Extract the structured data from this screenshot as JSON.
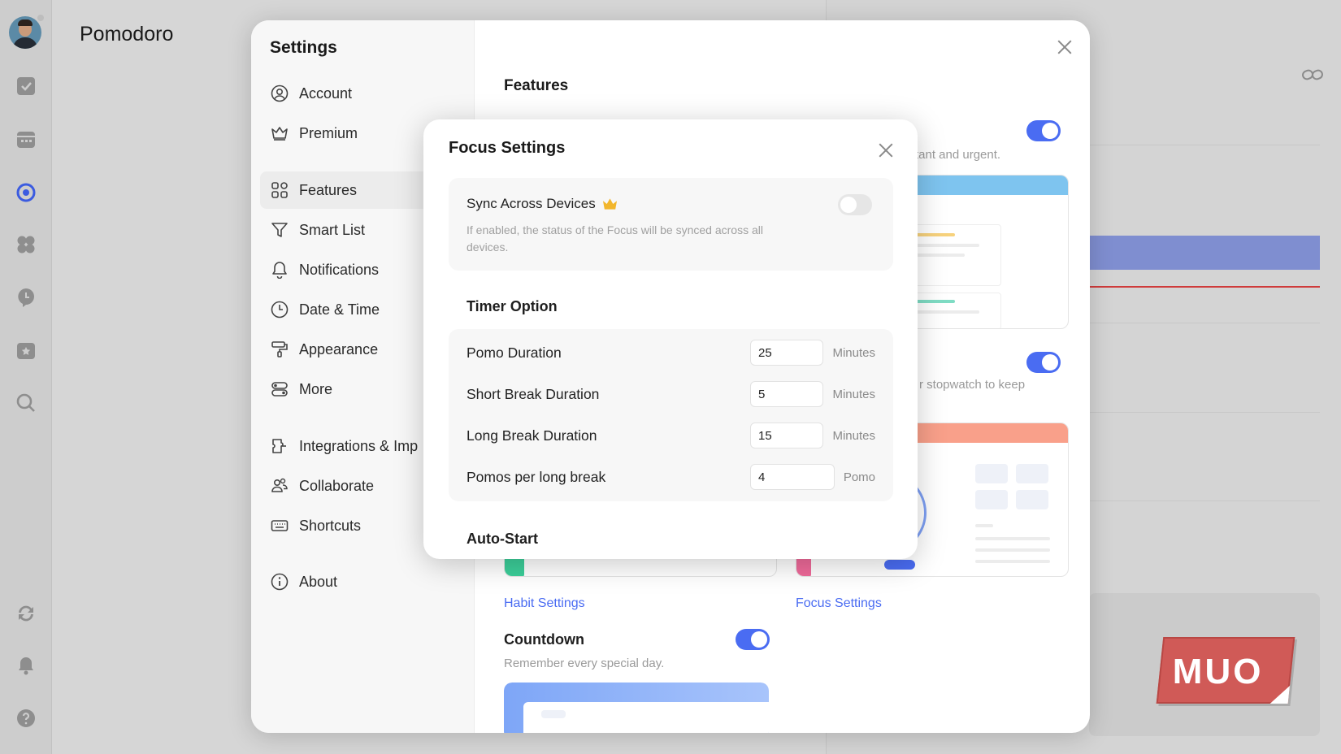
{
  "app": {
    "title": "Pomodoro"
  },
  "rail": {
    "icons": [
      "avatar",
      "checkbox-icon",
      "calendar-icon",
      "pomodoro-icon",
      "matrix-icon",
      "habit-icon",
      "countdown-icon",
      "search-icon",
      "sync-icon",
      "bell-icon",
      "help-icon"
    ]
  },
  "settings": {
    "title": "Settings",
    "nav": [
      {
        "label": "Account",
        "icon": "user-circle-icon"
      },
      {
        "label": "Premium",
        "icon": "crown-icon"
      },
      {
        "label": "Features",
        "icon": "grid-icon",
        "active": true
      },
      {
        "label": "Smart List",
        "icon": "filter-icon"
      },
      {
        "label": "Notifications",
        "icon": "bell-icon"
      },
      {
        "label": "Date & Time",
        "icon": "clock-icon"
      },
      {
        "label": "Appearance",
        "icon": "paint-roller-icon"
      },
      {
        "label": "More",
        "icon": "toggles-icon"
      },
      {
        "label": "Integrations & Imp",
        "icon": "integration-icon"
      },
      {
        "label": "Collaborate",
        "icon": "people-icon"
      },
      {
        "label": "Shortcuts",
        "icon": "keyboard-icon"
      },
      {
        "label": "About",
        "icon": "info-icon"
      }
    ],
    "main": {
      "title": "Features",
      "matrix_desc_fragment": "rtant and urgent.",
      "pomo_desc_fragment": "r stopwatch to keep",
      "habit_link": "Habit Settings",
      "focus_link": "Focus Settings",
      "countdown": {
        "name": "Countdown",
        "desc": "Remember every special day.",
        "enabled": true
      }
    }
  },
  "focus": {
    "title": "Focus Settings",
    "sync": {
      "label": "Sync Across Devices",
      "desc": "If enabled, the status of the Focus will be synced across all devices.",
      "enabled": false
    },
    "timer_section": "Timer Option",
    "timer_rows": [
      {
        "label": "Pomo Duration",
        "value": "25",
        "unit": "Minutes"
      },
      {
        "label": "Short Break Duration",
        "value": "5",
        "unit": "Minutes"
      },
      {
        "label": "Long Break Duration",
        "value": "15",
        "unit": "Minutes"
      },
      {
        "label": "Pomos per long break",
        "value": "4",
        "unit": "Pomo"
      }
    ],
    "auto_start_section": "Auto-Start"
  },
  "watermark": {
    "text": "MUO"
  },
  "colors": {
    "accent": "#4a6cf2",
    "toggle_off": "#e6e6e6",
    "watermark": "#d05a57"
  }
}
